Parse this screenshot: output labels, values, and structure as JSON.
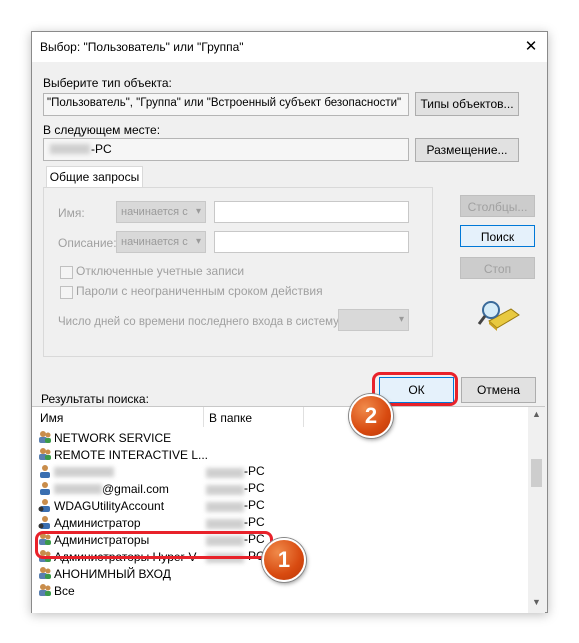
{
  "window": {
    "title": "Выбор: \"Пользователь\" или \"Группа\"",
    "close_glyph": "✕"
  },
  "object_type": {
    "label": "Выберите тип объекта:",
    "value": "\"Пользователь\", \"Группа\" или \"Встроенный субъект безопасности\"",
    "button": "Типы объектов..."
  },
  "location": {
    "label": "В следующем месте:",
    "value": "-PC",
    "button": "Размещение..."
  },
  "tab": {
    "label": "Общие запросы"
  },
  "query": {
    "name_label": "Имя:",
    "desc_label": "Описание:",
    "combo_value": "начинается с",
    "disabled_accounts": "Отключенные учетные записи",
    "nonexpiring_passwords": "Пароли с неограниченным сроком действия",
    "days_label": "Число дней со времени последнего входа в систему:"
  },
  "buttons": {
    "columns": "Столбцы...",
    "search": "Поиск",
    "stop": "Стоп",
    "ok": "ОК",
    "cancel": "Отмена"
  },
  "results": {
    "label": "Результаты поиска:",
    "col_name": "Имя",
    "col_folder": "В папке",
    "rows": [
      {
        "name": "NETWORK SERVICE",
        "folder": ""
      },
      {
        "name": "REMOTE INTERACTIVE L...",
        "folder": ""
      },
      {
        "name": "",
        "folder": "-PC"
      },
      {
        "name": "@gmail.com",
        "folder": "-PC"
      },
      {
        "name": "WDAGUtilityAccount",
        "folder": "-PC"
      },
      {
        "name": "Администратор",
        "folder": "-PC"
      },
      {
        "name": "Администраторы",
        "folder": "-PC"
      },
      {
        "name": "Администраторы Hyper-V",
        "folder": "-PC"
      },
      {
        "name": "АНОНИМНЫЙ ВХОД",
        "folder": ""
      },
      {
        "name": "Все",
        "folder": ""
      }
    ]
  },
  "annotations": {
    "badge1": "1",
    "badge2": "2"
  },
  "colors": {
    "accent": "#0078d7",
    "highlight": "#e8222a",
    "badge": "#d84a10"
  }
}
